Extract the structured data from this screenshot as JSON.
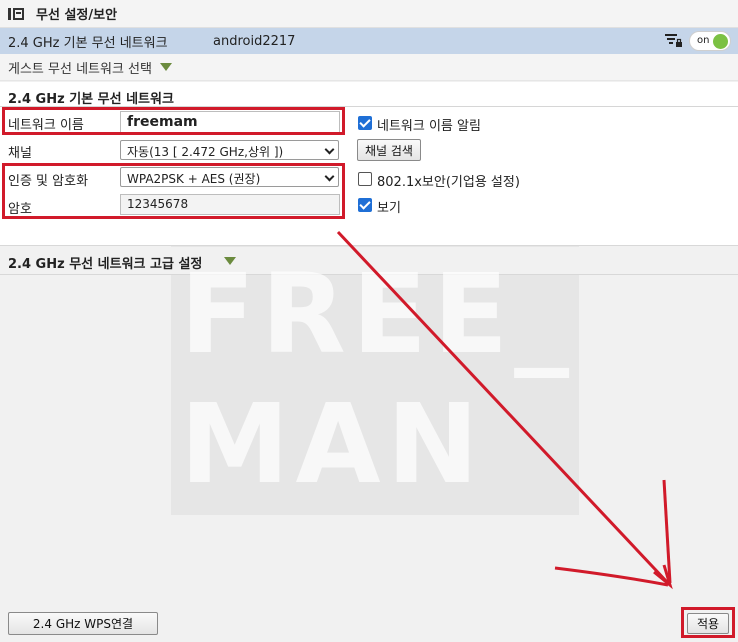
{
  "header": {
    "title": "무선 설정/보안",
    "icon": "panel-icon"
  },
  "network_bar": {
    "label": "2.4 GHz 기본 무선 네트워크",
    "ssid": "android2217",
    "toggle_label": "on",
    "toggle_color": "#7bc143"
  },
  "guest": {
    "label": "게스트 무선 네트워크 선택"
  },
  "basic": {
    "title": "2.4 GHz 기본 무선 네트워크",
    "network_name_label": "네트워크 이름",
    "network_name_value": "freemam",
    "broadcast_label": "네트워크 이름 알림",
    "broadcast_checked": true,
    "channel_label": "채널",
    "channel_value": "자동(13 [ 2.472 GHz,상위 ])",
    "channel_search_label": "채널 검색",
    "auth_label": "인증 및 암호화",
    "auth_value": "WPA2PSK + AES (권장)",
    "dot1x_label": "802.1x보안(기업용 설정)",
    "dot1x_checked": false,
    "password_label": "암호",
    "password_value": "12345678",
    "show_label": "보기",
    "show_checked": true
  },
  "advanced": {
    "label": "2.4 GHz 무선 네트워크 고급 설정"
  },
  "watermark": {
    "line1": "FREE_",
    "line2": "MAN"
  },
  "footer": {
    "wps_button": "2.4 GHz WPS연결",
    "apply_button": "적용"
  },
  "colors": {
    "accent_red": "#d11a2a",
    "netbar_bg": "#c5d5e9",
    "checkbox_blue": "#1f6fd6",
    "triangle_green": "#6b8b3e"
  }
}
